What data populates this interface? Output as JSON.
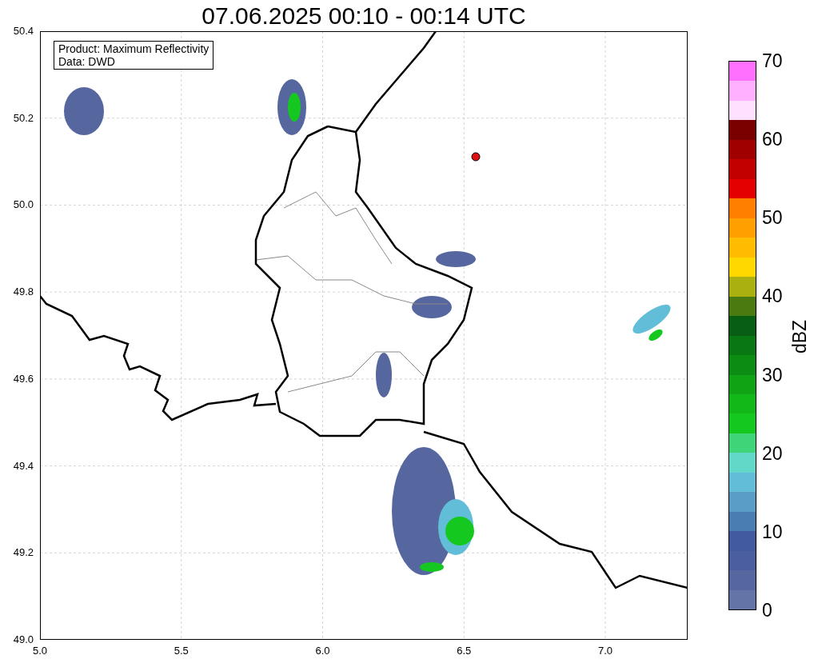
{
  "title": "07.06.2025 00:10 - 00:14 UTC",
  "info_box": [
    "Product: Maximum Reflectivity",
    "Data: DWD"
  ],
  "y_ticks": [
    "50.4",
    "50.2",
    "50.0",
    "49.8",
    "49.6",
    "49.4",
    "49.2",
    "49.0"
  ],
  "x_ticks": [
    "5.0",
    "5.5",
    "6.0",
    "6.5",
    "7.0"
  ],
  "colorbar": {
    "unit": "dBZ",
    "labels": [
      "70",
      "60",
      "50",
      "40",
      "30",
      "20",
      "10",
      "0"
    ],
    "bins": [
      {
        "color": "#ff70ff"
      },
      {
        "color": "#ffb0ff"
      },
      {
        "color": "#ffe0ff"
      },
      {
        "color": "#7a0000"
      },
      {
        "color": "#a00000"
      },
      {
        "color": "#c20000"
      },
      {
        "color": "#e40000"
      },
      {
        "color": "#ff8000"
      },
      {
        "color": "#ffa000"
      },
      {
        "color": "#ffbc00"
      },
      {
        "color": "#ffd800"
      },
      {
        "color": "#aab010"
      },
      {
        "color": "#4a7a10"
      },
      {
        "color": "#085e12"
      },
      {
        "color": "#0a7812"
      },
      {
        "color": "#0c8c12"
      },
      {
        "color": "#10a414"
      },
      {
        "color": "#12b818"
      },
      {
        "color": "#14c820"
      },
      {
        "color": "#40d478"
      },
      {
        "color": "#62d8c8"
      },
      {
        "color": "#62bed8"
      },
      {
        "color": "#5a9ec8"
      },
      {
        "color": "#4a7db2"
      },
      {
        "color": "#425aa0"
      },
      {
        "color": "#4a5ea0"
      },
      {
        "color": "#5667a0"
      },
      {
        "color": "#6474a6"
      }
    ]
  }
}
